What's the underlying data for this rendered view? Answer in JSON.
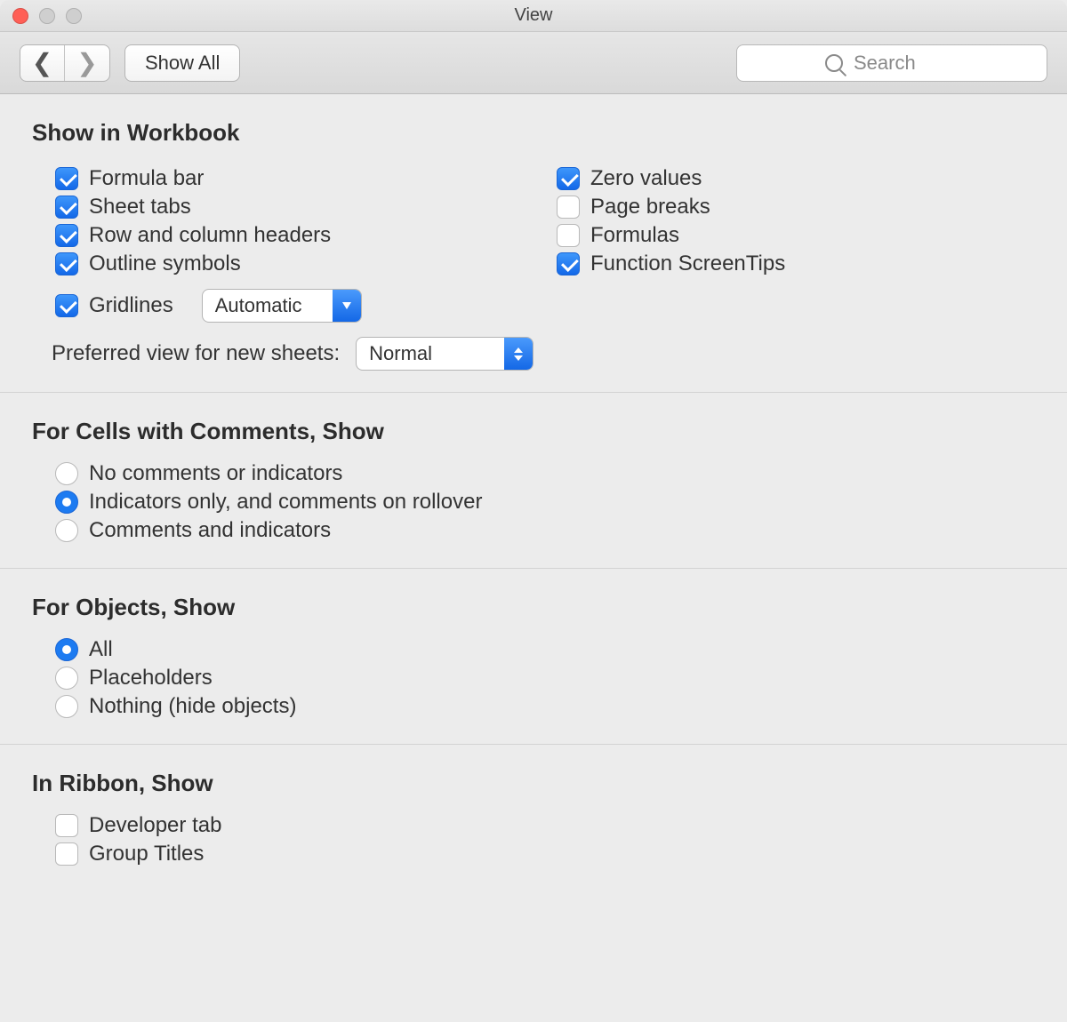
{
  "window": {
    "title": "View"
  },
  "toolbar": {
    "show_all": "Show All",
    "search_placeholder": "Search"
  },
  "sections": {
    "show_in_workbook": {
      "title": "Show in Workbook",
      "left": [
        {
          "label": "Formula bar",
          "checked": true
        },
        {
          "label": "Sheet tabs",
          "checked": true
        },
        {
          "label": "Row and column headers",
          "checked": true
        },
        {
          "label": "Outline symbols",
          "checked": true
        }
      ],
      "right": [
        {
          "label": "Zero values",
          "checked": true
        },
        {
          "label": "Page breaks",
          "checked": false
        },
        {
          "label": "Formulas",
          "checked": false
        },
        {
          "label": "Function ScreenTips",
          "checked": true
        }
      ],
      "gridlines": {
        "label": "Gridlines",
        "checked": true,
        "mode": "Automatic"
      },
      "pref_view": {
        "label": "Preferred view for new sheets:",
        "value": "Normal"
      }
    },
    "comments": {
      "title": "For Cells with Comments, Show",
      "options": [
        {
          "label": "No comments or indicators",
          "selected": false
        },
        {
          "label": "Indicators only, and comments on rollover",
          "selected": true
        },
        {
          "label": "Comments and indicators",
          "selected": false
        }
      ]
    },
    "objects": {
      "title": "For Objects, Show",
      "options": [
        {
          "label": "All",
          "selected": true
        },
        {
          "label": "Placeholders",
          "selected": false
        },
        {
          "label": "Nothing (hide objects)",
          "selected": false
        }
      ]
    },
    "ribbon": {
      "title": "In Ribbon, Show",
      "options": [
        {
          "label": "Developer tab",
          "checked": false
        },
        {
          "label": "Group Titles",
          "checked": false
        }
      ]
    }
  }
}
